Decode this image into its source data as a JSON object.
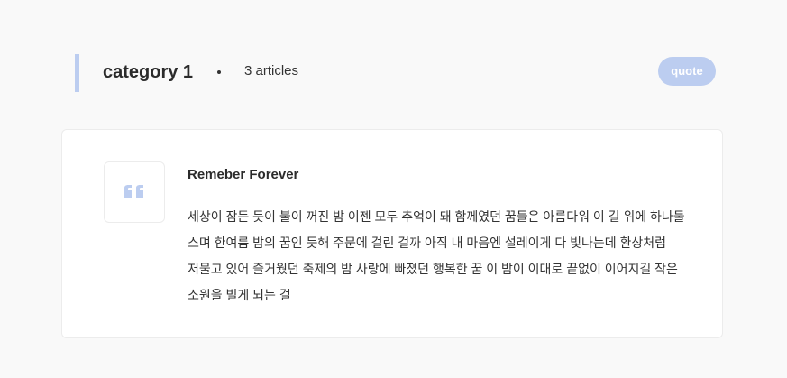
{
  "header": {
    "category": "category 1",
    "article_count": "3 articles",
    "badge_label": "quote"
  },
  "post": {
    "title": "Remeber Forever",
    "body": "세상이 잠든 듯이 불이 꺼진 밤 이젠 모두 추억이 돼 함께였던 꿈들은 아름다워 이 길 위에 하나둘 스며 한여름 밤의 꿈인 듯해 주문에 걸린 걸까 아직 내 마음엔 설레이게 다 빛나는데 환상처럼 저물고 있어 즐거웠던 축제의 밤 사랑에 빠졌던 행복한 꿈 이 밤이 이대로 끝없이 이어지길 작은 소원을 빌게 되는 걸",
    "icon": "quote-mark-icon"
  },
  "colors": {
    "accent": "#bccdf0",
    "background": "#f9f9f9",
    "card": "#ffffff",
    "text": "#333333"
  }
}
